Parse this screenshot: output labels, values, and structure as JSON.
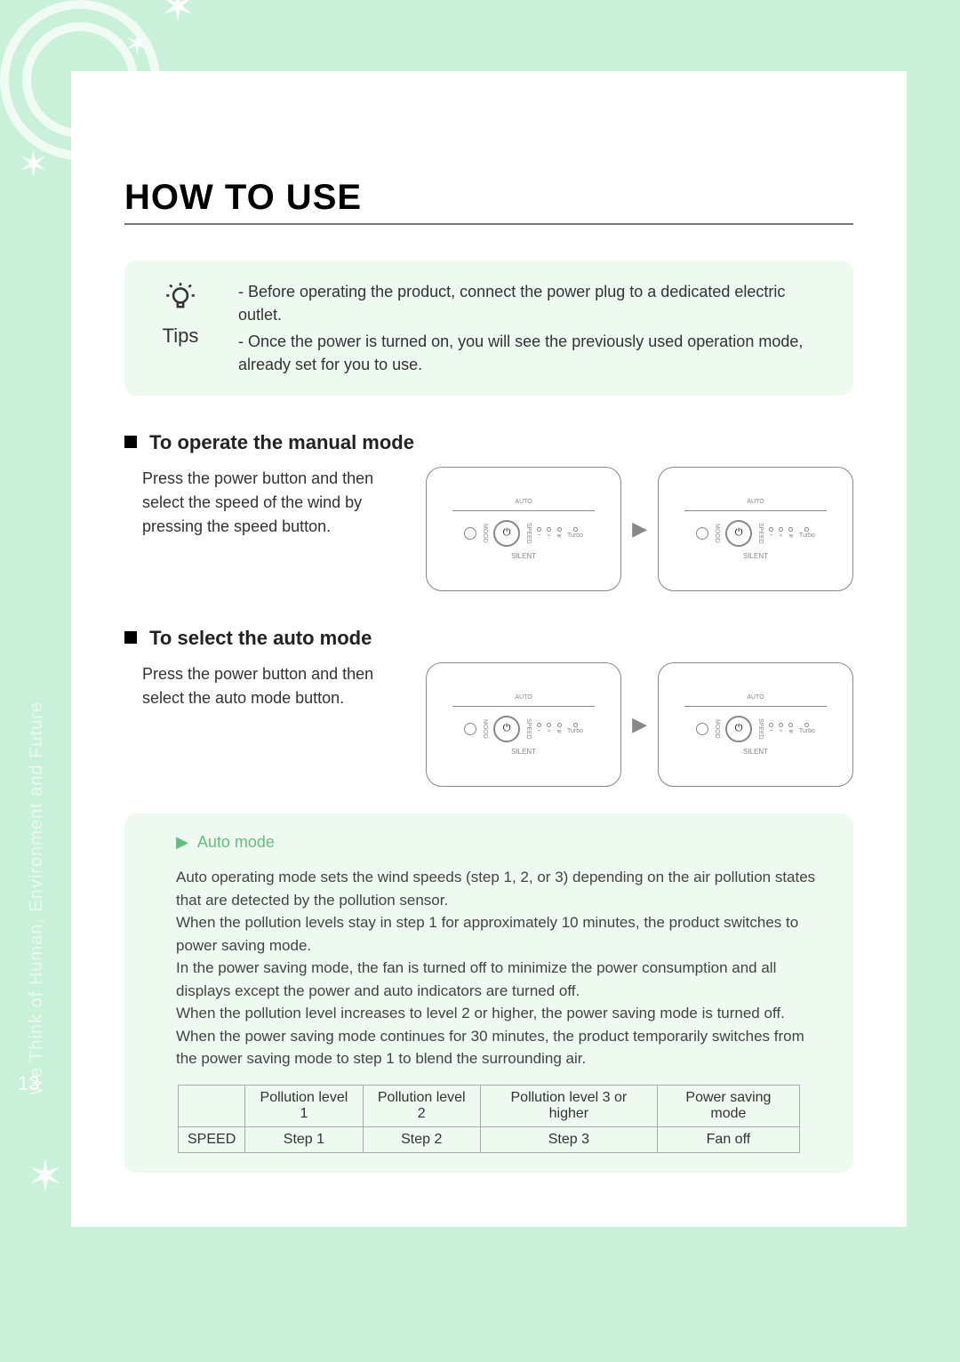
{
  "page_number": "13",
  "sidebar_tagline": "We Think of Human, Environment and Future",
  "title": "HOW TO USE",
  "tips": {
    "label": "Tips",
    "line1": "- Before operating the product, connect the power plug to a dedicated electric outlet.",
    "line2": "- Once the power is turned on, you will see the previously used operation mode, already set for you to use."
  },
  "section_manual": {
    "heading": "To operate the manual mode",
    "text": "Press the power button and then select the speed of the wind by pressing the speed button."
  },
  "section_auto": {
    "heading": "To select the auto mode",
    "text": "Press the power button and then select the auto mode button."
  },
  "panel": {
    "auto": "AUTO",
    "mood": "MOOD",
    "speed": "SPEED",
    "silent": "SILENT",
    "turbo": "Turbo"
  },
  "automode": {
    "title": "Auto mode",
    "p1": "Auto operating mode sets the wind speeds (step 1, 2, or 3) depending on the air pollution states that are detected by the pollution sensor.",
    "p2": "When the pollution levels stay in step 1 for approximately 10 minutes, the product switches to power saving mode.",
    "p3": "In the power saving mode, the fan is turned off to minimize the power consumption and all displays except the power and auto indicators are turned off.",
    "p4": "When the pollution level increases to level 2 or higher, the power saving mode is turned off.",
    "p5": "When the power saving mode continues for 30 minutes, the product temporarily switches from the power saving mode to step 1 to blend the surrounding air."
  },
  "table": {
    "row_label": "SPEED",
    "headers": [
      "Pollution level 1",
      "Pollution level 2",
      "Pollution level 3 or higher",
      "Power saving mode"
    ],
    "values": [
      "Step 1",
      "Step 2",
      "Step 3",
      "Fan off"
    ]
  }
}
